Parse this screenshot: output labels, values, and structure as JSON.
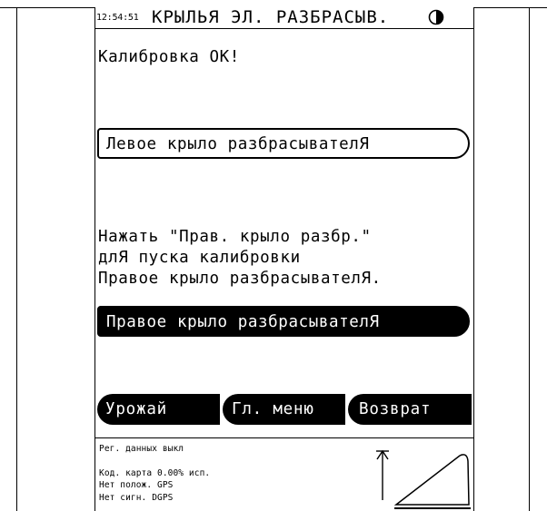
{
  "header": {
    "clock": "12:54:51",
    "title": "КРЫЛЬЯ ЭЛ. РАЗБРАСЫВ.",
    "contrast_icon": "half-filled-circle"
  },
  "main": {
    "status_line": "Калибровка ОК!",
    "left_wing_button": "Левое крыло разбрасывателЯ",
    "instruction_lines": [
      "Нажать \"Прав. крыло разбр.\"",
      "длЯ пуска калибровки",
      "Правое крыло разбрасывателЯ."
    ],
    "right_wing_button": "Правое крыло разбрасывателЯ"
  },
  "softkeys": {
    "harvest": "Урожай",
    "main_menu": "Гл. меню",
    "back": "Возврат"
  },
  "status": {
    "data_logging": "Рег. данных выкл",
    "map_code": "Код. карта   0.00% исп.",
    "position": "Нет полож. GPS",
    "dgps": "Нет сигн. DGPS"
  },
  "icons": {
    "up_arrow": "up-arrow-icon",
    "wing_graphic": "spreader-wing-icon"
  }
}
